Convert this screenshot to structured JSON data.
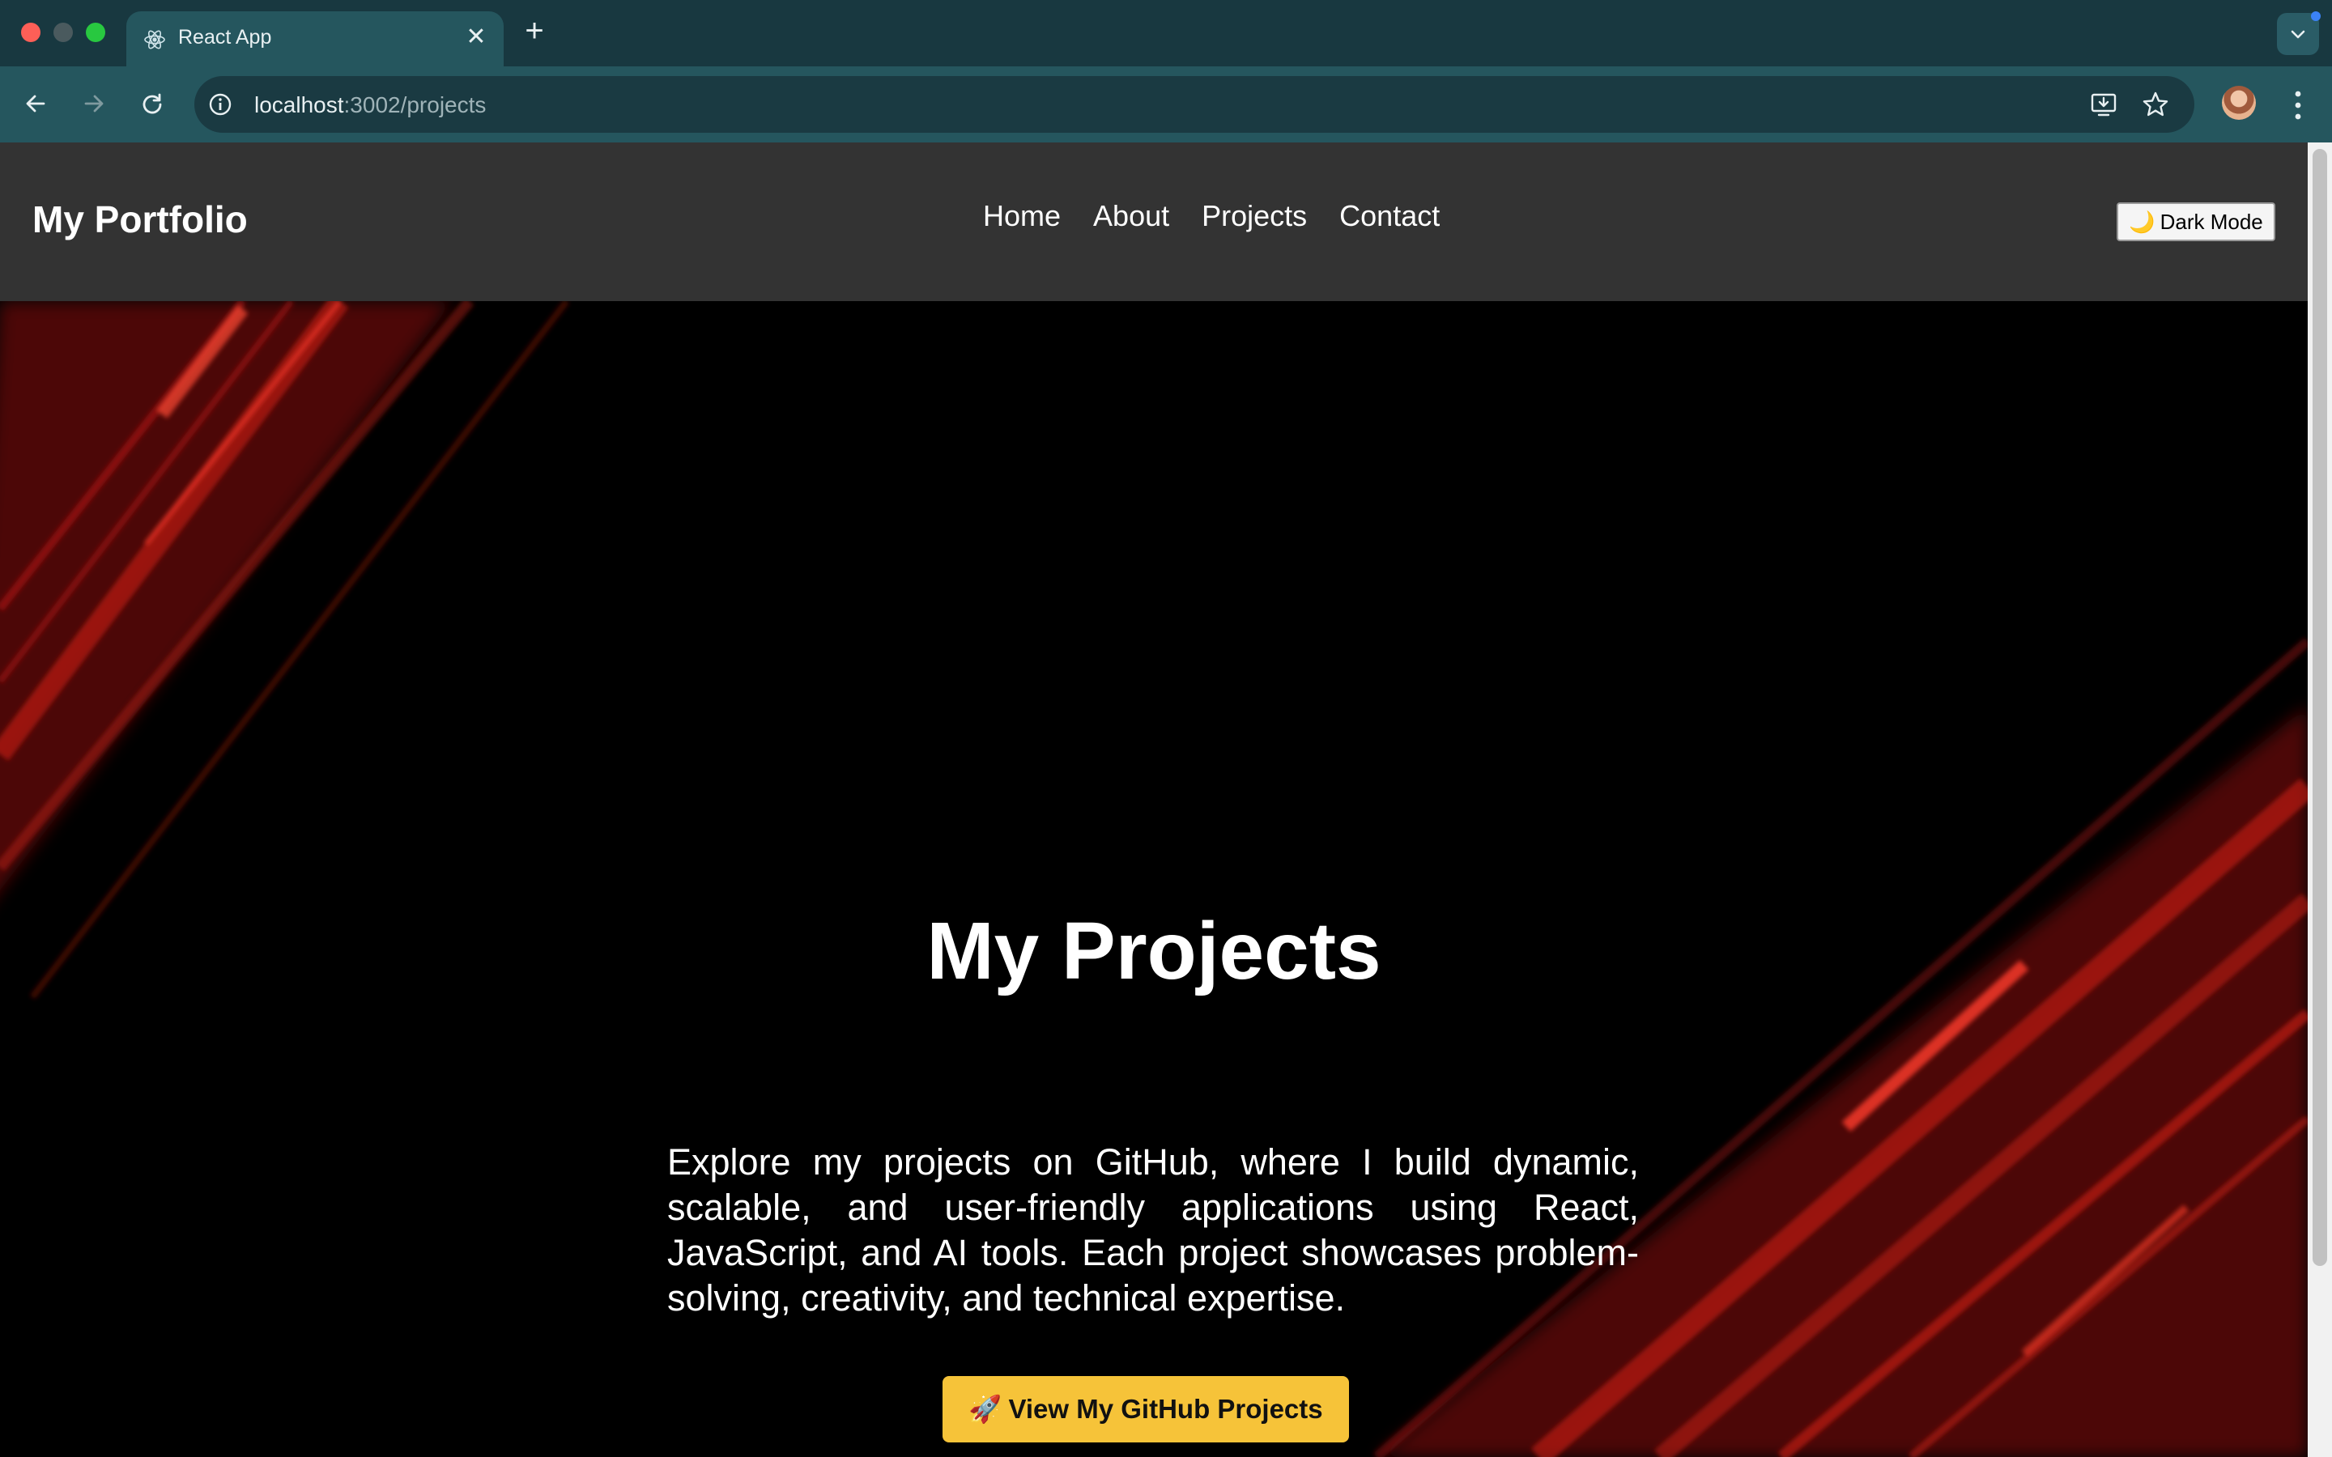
{
  "browser": {
    "tab_title": "React App",
    "url_host": "localhost",
    "url_path": ":3002/projects",
    "icons": {
      "favicon": "react-logo-icon",
      "tab_close": "close-icon",
      "new_tab": "plus-icon",
      "tab_search": "chevron-down-icon",
      "back": "back-arrow-icon",
      "forward": "forward-arrow-icon",
      "reload": "reload-icon",
      "site_info": "info-icon",
      "install": "install-app-icon",
      "bookmark": "star-icon",
      "profile": "avatar",
      "menu": "kebab-menu-icon"
    },
    "new_tab_glyph": "+",
    "close_glyph": "✕"
  },
  "site": {
    "logo": "My Portfolio",
    "nav": [
      {
        "label": "Home"
      },
      {
        "label": "About"
      },
      {
        "label": "Projects"
      },
      {
        "label": "Contact"
      }
    ],
    "mode_toggle": {
      "icon": "🌙",
      "label": "Dark Mode"
    }
  },
  "hero": {
    "title": "My Projects",
    "description": "Explore my projects on GitHub, where I build dynamic, scalable, and user-friendly applications using React, JavaScript, and AI tools. Each project showcases problem-solving, creativity, and technical expertise.",
    "cta": {
      "icon": "🚀",
      "label": "View My GitHub Projects"
    }
  },
  "colors": {
    "header_bg": "#333333",
    "hero_bg": "#000000",
    "cta_bg": "#f6c339",
    "streak": "#e0241a"
  }
}
